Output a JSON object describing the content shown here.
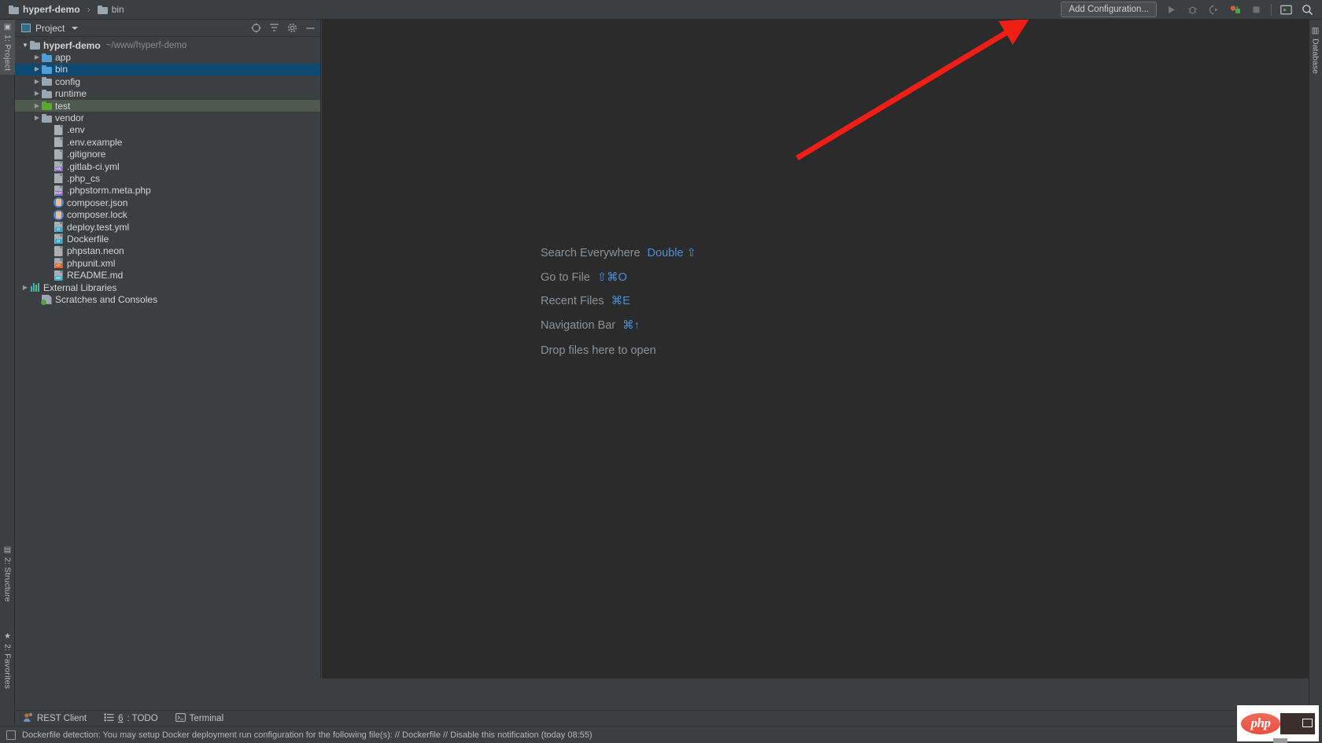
{
  "breadcrumb": {
    "items": [
      {
        "label": "hyperf-demo",
        "icon": "folder-icon",
        "bold": true
      },
      {
        "label": "bin",
        "icon": "folder-icon",
        "bold": false
      }
    ],
    "separator": "›"
  },
  "toolbar": {
    "add_configuration_label": "Add Configuration...",
    "icons": [
      "run-icon",
      "debug-icon",
      "coverage-icon",
      "profile-icon",
      "stop-icon",
      "terminal-icon",
      "search-icon"
    ]
  },
  "left_tool_strip": {
    "tabs": [
      {
        "label": "1: Project",
        "icon": "project-icon",
        "selected": true
      },
      {
        "label": "2: Structure",
        "icon": "structure-icon",
        "selected": false
      },
      {
        "label": "2: Favorites",
        "icon": "star-icon",
        "selected": false
      }
    ]
  },
  "right_tool_strip": {
    "tabs": [
      {
        "label": "Database",
        "icon": "database-icon"
      }
    ]
  },
  "project_panel": {
    "title": "Project",
    "actions": [
      "target-icon",
      "collapse-all-icon",
      "settings-gear-icon",
      "hide-icon"
    ],
    "tree": [
      {
        "label": "hyperf-demo",
        "path": "~/www/hyperf-demo",
        "icon": "folder-icon",
        "indent": 0,
        "arrow": "down",
        "bold": true,
        "selected": ""
      },
      {
        "label": "app",
        "path": "",
        "icon": "folder-blue-icon",
        "indent": 1,
        "arrow": "right",
        "bold": false,
        "selected": ""
      },
      {
        "label": "bin",
        "path": "",
        "icon": "folder-blue-icon",
        "indent": 1,
        "arrow": "right",
        "bold": false,
        "selected": "blue"
      },
      {
        "label": "config",
        "path": "",
        "icon": "folder-icon",
        "indent": 1,
        "arrow": "right",
        "bold": false,
        "selected": ""
      },
      {
        "label": "runtime",
        "path": "",
        "icon": "folder-icon",
        "indent": 1,
        "arrow": "right",
        "bold": false,
        "selected": ""
      },
      {
        "label": "test",
        "path": "",
        "icon": "folder-green-icon",
        "indent": 1,
        "arrow": "right",
        "bold": false,
        "selected": "green"
      },
      {
        "label": "vendor",
        "path": "",
        "icon": "folder-icon",
        "indent": 1,
        "arrow": "right",
        "bold": false,
        "selected": ""
      },
      {
        "label": ".env",
        "path": "",
        "icon": "file-text-icon",
        "indent": 2,
        "arrow": "",
        "bold": false,
        "selected": ""
      },
      {
        "label": ".env.example",
        "path": "",
        "icon": "file-text-icon",
        "indent": 2,
        "arrow": "",
        "bold": false,
        "selected": ""
      },
      {
        "label": ".gitignore",
        "path": "",
        "icon": "file-text-icon",
        "indent": 2,
        "arrow": "",
        "bold": false,
        "selected": ""
      },
      {
        "label": ".gitlab-ci.yml",
        "path": "",
        "icon": "file-yml-icon",
        "indent": 2,
        "arrow": "",
        "bold": false,
        "selected": ""
      },
      {
        "label": ".php_cs",
        "path": "",
        "icon": "file-text-icon",
        "indent": 2,
        "arrow": "",
        "bold": false,
        "selected": ""
      },
      {
        "label": ".phpstorm.meta.php",
        "path": "",
        "icon": "file-php-icon",
        "indent": 2,
        "arrow": "",
        "bold": false,
        "selected": ""
      },
      {
        "label": "composer.json",
        "path": "",
        "icon": "composer-icon",
        "indent": 2,
        "arrow": "",
        "bold": false,
        "selected": ""
      },
      {
        "label": "composer.lock",
        "path": "",
        "icon": "composer-icon",
        "indent": 2,
        "arrow": "",
        "bold": false,
        "selected": ""
      },
      {
        "label": "deploy.test.yml",
        "path": "",
        "icon": "file-docker-icon",
        "indent": 2,
        "arrow": "",
        "bold": false,
        "selected": ""
      },
      {
        "label": "Dockerfile",
        "path": "",
        "icon": "file-docker-icon",
        "indent": 2,
        "arrow": "",
        "bold": false,
        "selected": ""
      },
      {
        "label": "phpstan.neon",
        "path": "",
        "icon": "file-text-icon",
        "indent": 2,
        "arrow": "",
        "bold": false,
        "selected": ""
      },
      {
        "label": "phpunit.xml",
        "path": "",
        "icon": "file-xml-icon",
        "indent": 2,
        "arrow": "",
        "bold": false,
        "selected": ""
      },
      {
        "label": "README.md",
        "path": "",
        "icon": "file-md-icon",
        "indent": 2,
        "arrow": "",
        "bold": false,
        "selected": ""
      },
      {
        "label": "External Libraries",
        "path": "",
        "icon": "libraries-icon",
        "indent": 0,
        "arrow": "right",
        "bold": false,
        "selected": ""
      },
      {
        "label": "Scratches and Consoles",
        "path": "",
        "icon": "scratches-icon",
        "indent": 1,
        "arrow": "",
        "bold": false,
        "selected": ""
      }
    ]
  },
  "editor": {
    "hints": [
      {
        "label": "Search Everywhere",
        "shortcut": "Double ⇧"
      },
      {
        "label": "Go to File",
        "shortcut": "⇧⌘O"
      },
      {
        "label": "Recent Files",
        "shortcut": "⌘E"
      },
      {
        "label": "Navigation Bar",
        "shortcut": "⌘↑"
      }
    ],
    "drop_hint": "Drop files here to open",
    "annotation_color": "#f01e15"
  },
  "bottom_bar": {
    "items": [
      {
        "label": "REST Client",
        "icon": "rest-client-icon",
        "prefix": ""
      },
      {
        "label": ": TODO",
        "icon": "todo-icon",
        "prefix": "6"
      },
      {
        "label": "Terminal",
        "icon": "terminal-icon",
        "prefix": ""
      }
    ]
  },
  "status_bar": {
    "icon": "notification-icon",
    "message": "Dockerfile detection: You may setup Docker deployment run configuration for the following file(s): // Dockerfile // Disable this notification (today 08:55)"
  },
  "php_widget": {
    "logo_text": "php"
  },
  "colors": {
    "panel_bg": "#3c3f41",
    "editor_bg": "#2b2b2b",
    "selection_blue": "#0d4a73",
    "selection_green": "#4d5a4d",
    "accent_blue": "#4a90d9",
    "annotation_red": "#f01e15"
  }
}
